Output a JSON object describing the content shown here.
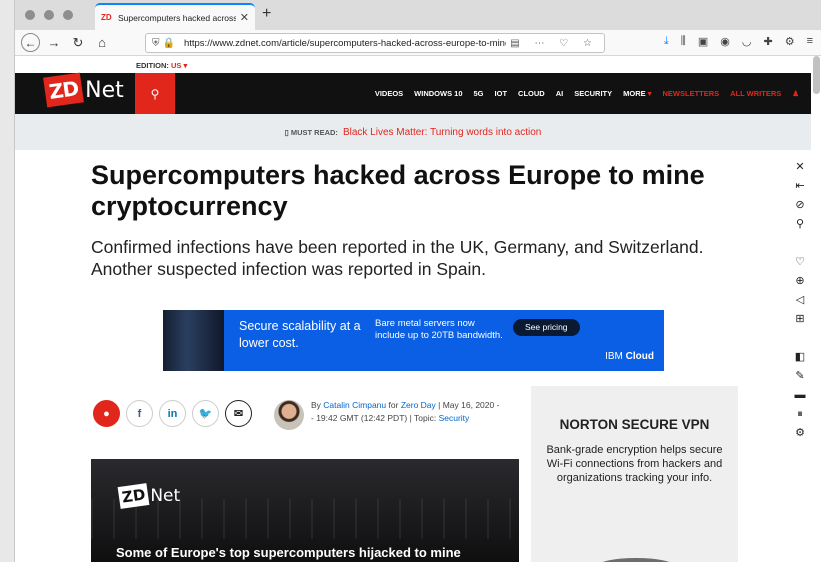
{
  "browser": {
    "tab_title": "Supercomputers hacked across Europe to mine cryptocurrency",
    "url": "https://www.zdnet.com/article/supercomputers-hacked-across-europe-to-mine-cryptocurrency/"
  },
  "edition": {
    "label": "EDITION:",
    "value": "US"
  },
  "nav": {
    "items": [
      "VIDEOS",
      "WINDOWS 10",
      "5G",
      "IOT",
      "CLOUD",
      "AI",
      "SECURITY",
      "MORE"
    ],
    "newsletters": "NEWSLETTERS",
    "all_writers": "ALL WRITERS"
  },
  "must_read": {
    "label": "MUST READ:",
    "link": "Black Lives Matter: Turning words into action"
  },
  "article": {
    "headline": "Supercomputers hacked across Europe to mine cryptocurrency",
    "subhead": "Confirmed infections have been reported in the UK, Germany, and Switzerland. Another suspected infection was reported in Spain.",
    "byline_prefix": "By",
    "author": "Catalin Cimpanu",
    "for": "for",
    "column": "Zero Day",
    "date": "| May 16, 2020 -- 19:42 GMT (12:42 PDT) | Topic:",
    "topic": "Security",
    "hero_caption": "Some of Europe's top supercomputers hijacked to mine"
  },
  "ad": {
    "line1": "Secure scalability at a lower cost.",
    "line2": "Bare metal servers now include up to 20TB bandwidth.",
    "cta": "See pricing",
    "brand_prefix": "IBM",
    "brand": "Cloud"
  },
  "norton": {
    "title": "NORTON SECURE VPN",
    "body": "Bank-grade encryption helps secure Wi-Fi connections from hackers and organizations tracking your info."
  },
  "colors": {
    "zdnet_red": "#e1261c",
    "header_black": "#111111",
    "ad_blue": "#0a5fe5"
  }
}
